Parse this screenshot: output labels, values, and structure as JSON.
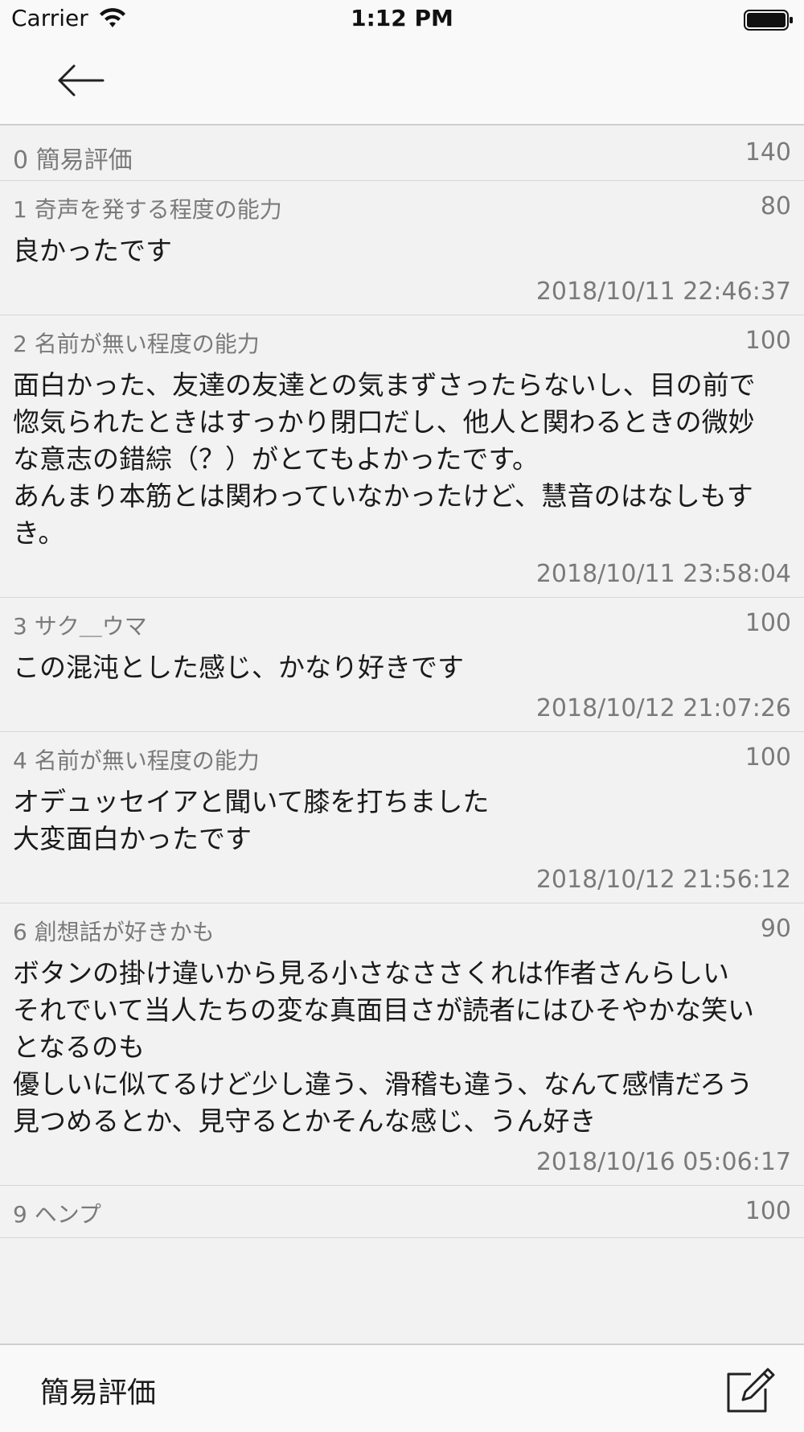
{
  "status_bar": {
    "carrier": "Carrier",
    "time": "1:12 PM",
    "wifi_icon": "wifi-icon",
    "battery_icon": "battery-icon"
  },
  "nav": {
    "back_icon": "arrow-left-icon"
  },
  "list": {
    "section": {
      "index": "0",
      "title": "簡易評価",
      "count": "140"
    },
    "rows": [
      {
        "index": "1",
        "name": "奇声を発する程度の能力",
        "score": "80",
        "body": "良かったです",
        "timestamp": "2018/10/11 22:46:37"
      },
      {
        "index": "2",
        "name": "名前が無い程度の能力",
        "score": "100",
        "body": "面白かった、友達の友達との気まずさったらないし、目の前で惚気られたときはすっかり閉口だし、他人と関わるときの微妙な意志の錯綜（？）がとてもよかったです。\nあんまり本筋とは関わっていなかったけど、慧音のはなしもすき。",
        "timestamp": "2018/10/11 23:58:04"
      },
      {
        "index": "3",
        "name": "サク＿ウマ",
        "score": "100",
        "body": "この混沌とした感じ、かなり好きです",
        "timestamp": "2018/10/12 21:07:26"
      },
      {
        "index": "4",
        "name": "名前が無い程度の能力",
        "score": "100",
        "body": "オデュッセイアと聞いて膝を打ちました\n大変面白かったです",
        "timestamp": "2018/10/12 21:56:12"
      },
      {
        "index": "6",
        "name": "創想話が好きかも",
        "score": "90",
        "body": "ボタンの掛け違いから見る小さなささくれは作者さんらしい\nそれでいて当人たちの変な真面目さが読者にはひそやかな笑いとなるのも\n優しいに似てるけど少し違う、滑稽も違う、なんて感情だろう\n見つめるとか、見守るとかそんな感じ、うん好き",
        "timestamp": "2018/10/16 05:06:17"
      },
      {
        "index": "9",
        "name": "ヘンプ",
        "score": "100",
        "body": "",
        "timestamp": ""
      }
    ]
  },
  "tab_bar": {
    "label": "簡易評価",
    "compose_icon": "compose-icon"
  }
}
